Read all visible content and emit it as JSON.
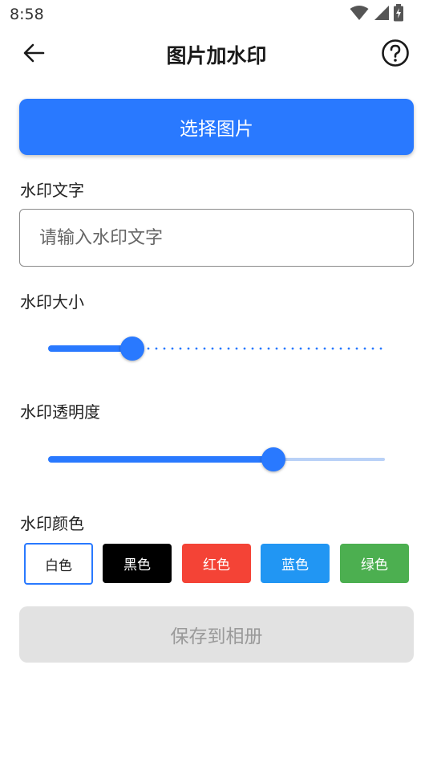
{
  "status_bar": {
    "time": "8:58",
    "icons": [
      "wifi-icon",
      "cellular-signal-icon",
      "battery-charging-icon"
    ]
  },
  "app_bar": {
    "title": "图片加水印",
    "back_icon": "arrow-left-icon",
    "help_icon": "help-circle-icon"
  },
  "select_image": {
    "label": "选择图片"
  },
  "watermark_text": {
    "label": "水印文字",
    "value": "",
    "placeholder": "请输入水印文字"
  },
  "watermark_size": {
    "label": "水印大小",
    "value_fraction": 0.25,
    "style": "discrete"
  },
  "watermark_opacity": {
    "label": "水印透明度",
    "value_fraction": 0.67
  },
  "watermark_color": {
    "label": "水印颜色",
    "selected": "白色",
    "options": [
      {
        "label": "白色",
        "color": "#ffffff",
        "text_color": "#222222"
      },
      {
        "label": "黑色",
        "color": "#000000",
        "text_color": "#ffffff"
      },
      {
        "label": "红色",
        "color": "#f44336",
        "text_color": "#ffffff"
      },
      {
        "label": "蓝色",
        "color": "#2196f3",
        "text_color": "#ffffff"
      },
      {
        "label": "绿色",
        "color": "#4caf50",
        "text_color": "#ffffff"
      }
    ]
  },
  "save": {
    "label": "保存到相册",
    "enabled": false
  },
  "colors": {
    "accent": "#2979ff",
    "disabled_bg": "#e2e2e2",
    "disabled_text": "#9a9a9a"
  }
}
